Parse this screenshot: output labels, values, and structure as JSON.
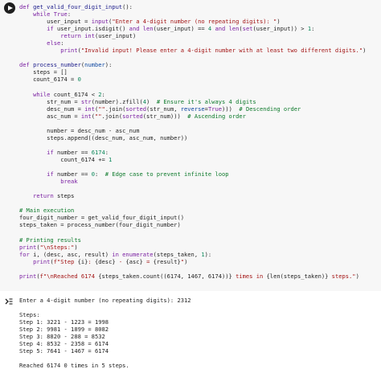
{
  "code_cell": {
    "lines": [
      [
        [
          "k",
          "def "
        ],
        [
          "d",
          "get_valid_four_digit_input"
        ],
        [
          "p",
          "():"
        ]
      ],
      [
        [
          "p",
          "    "
        ],
        [
          "k",
          "while "
        ],
        [
          "k",
          "True"
        ],
        [
          "p",
          ":"
        ]
      ],
      [
        [
          "p",
          "        user_input = "
        ],
        [
          "b",
          "input"
        ],
        [
          "p",
          "("
        ],
        [
          "s",
          "\"Enter a 4-digit number (no repeating digits): \""
        ],
        [
          "p",
          ")"
        ]
      ],
      [
        [
          "p",
          "        "
        ],
        [
          "k",
          "if "
        ],
        [
          "p",
          "user_input.isdigit() "
        ],
        [
          "k",
          "and "
        ],
        [
          "b",
          "len"
        ],
        [
          "p",
          "(user_input) == "
        ],
        [
          "n",
          "4"
        ],
        [
          "p",
          " "
        ],
        [
          "k",
          "and "
        ],
        [
          "b",
          "len"
        ],
        [
          "p",
          "("
        ],
        [
          "b",
          "set"
        ],
        [
          "p",
          "(user_input)) > "
        ],
        [
          "n",
          "1"
        ],
        [
          "p",
          ":"
        ]
      ],
      [
        [
          "p",
          "            "
        ],
        [
          "k",
          "return "
        ],
        [
          "b",
          "int"
        ],
        [
          "p",
          "(user_input)"
        ]
      ],
      [
        [
          "p",
          "        "
        ],
        [
          "k",
          "else"
        ],
        [
          "p",
          ":"
        ]
      ],
      [
        [
          "p",
          "            "
        ],
        [
          "b",
          "print"
        ],
        [
          "p",
          "("
        ],
        [
          "s",
          "\"Invalid input! Please enter a 4-digit number with at least two different digits.\""
        ],
        [
          "p",
          ")"
        ]
      ],
      [
        [
          "p",
          ""
        ]
      ],
      [
        [
          "k",
          "def "
        ],
        [
          "d",
          "process_number"
        ],
        [
          "p",
          "("
        ],
        [
          "v",
          "number"
        ],
        [
          "p",
          "):"
        ]
      ],
      [
        [
          "p",
          "    steps = []"
        ]
      ],
      [
        [
          "p",
          "    count_6174 = "
        ],
        [
          "n",
          "0"
        ]
      ],
      [
        [
          "p",
          ""
        ]
      ],
      [
        [
          "p",
          "    "
        ],
        [
          "k",
          "while "
        ],
        [
          "p",
          "count_6174 < "
        ],
        [
          "n",
          "2"
        ],
        [
          "p",
          ":"
        ]
      ],
      [
        [
          "p",
          "        str_num = "
        ],
        [
          "b",
          "str"
        ],
        [
          "p",
          "(number).zfill("
        ],
        [
          "n",
          "4"
        ],
        [
          "p",
          ")  "
        ],
        [
          "c",
          "# Ensure it's always 4 digits"
        ]
      ],
      [
        [
          "p",
          "        desc_num = "
        ],
        [
          "b",
          "int"
        ],
        [
          "p",
          "("
        ],
        [
          "s",
          "\"\""
        ],
        [
          "p",
          ".join("
        ],
        [
          "b",
          "sorted"
        ],
        [
          "p",
          "(str_num, "
        ],
        [
          "v",
          "reverse"
        ],
        [
          "p",
          "="
        ],
        [
          "k",
          "True"
        ],
        [
          "p",
          ")))  "
        ],
        [
          "c",
          "# Descending order"
        ]
      ],
      [
        [
          "p",
          "        asc_num = "
        ],
        [
          "b",
          "int"
        ],
        [
          "p",
          "("
        ],
        [
          "s",
          "\"\""
        ],
        [
          "p",
          ".join("
        ],
        [
          "b",
          "sorted"
        ],
        [
          "p",
          "(str_num)))  "
        ],
        [
          "c",
          "# Ascending order"
        ]
      ],
      [
        [
          "p",
          ""
        ]
      ],
      [
        [
          "p",
          "        number = desc_num - asc_num"
        ]
      ],
      [
        [
          "p",
          "        steps.append((desc_num, asc_num, number))"
        ]
      ],
      [
        [
          "p",
          ""
        ]
      ],
      [
        [
          "p",
          "        "
        ],
        [
          "k",
          "if "
        ],
        [
          "p",
          "number == "
        ],
        [
          "n",
          "6174"
        ],
        [
          "p",
          ":"
        ]
      ],
      [
        [
          "p",
          "            count_6174 += "
        ],
        [
          "n",
          "1"
        ]
      ],
      [
        [
          "p",
          ""
        ]
      ],
      [
        [
          "p",
          "        "
        ],
        [
          "k",
          "if "
        ],
        [
          "p",
          "number == "
        ],
        [
          "n",
          "0"
        ],
        [
          "p",
          ":  "
        ],
        [
          "c",
          "# Edge case to prevent infinite loop"
        ]
      ],
      [
        [
          "p",
          "            "
        ],
        [
          "k",
          "break"
        ]
      ],
      [
        [
          "p",
          ""
        ]
      ],
      [
        [
          "p",
          "    "
        ],
        [
          "k",
          "return "
        ],
        [
          "p",
          "steps"
        ]
      ],
      [
        [
          "p",
          ""
        ]
      ],
      [
        [
          "c",
          "# Main execution"
        ]
      ],
      [
        [
          "p",
          "four_digit_number = get_valid_four_digit_input()"
        ]
      ],
      [
        [
          "p",
          "steps_taken = process_number(four_digit_number)"
        ]
      ],
      [
        [
          "p",
          ""
        ]
      ],
      [
        [
          "c",
          "# Printing results"
        ]
      ],
      [
        [
          "b",
          "print"
        ],
        [
          "p",
          "("
        ],
        [
          "s",
          "\"\\nSteps:\""
        ],
        [
          "p",
          ")"
        ]
      ],
      [
        [
          "k",
          "for "
        ],
        [
          "p",
          "i, (desc, asc, result) "
        ],
        [
          "k",
          "in "
        ],
        [
          "b",
          "enumerate"
        ],
        [
          "p",
          "(steps_taken, "
        ],
        [
          "n",
          "1"
        ],
        [
          "p",
          "):"
        ]
      ],
      [
        [
          "p",
          "    "
        ],
        [
          "b",
          "print"
        ],
        [
          "p",
          "("
        ],
        [
          "s",
          "f\"Step "
        ],
        [
          "p",
          "{i}"
        ],
        [
          "s",
          ": "
        ],
        [
          "p",
          "{desc}"
        ],
        [
          "s",
          " - "
        ],
        [
          "p",
          "{asc}"
        ],
        [
          "s",
          " = "
        ],
        [
          "p",
          "{result}"
        ],
        [
          "s",
          "\""
        ],
        [
          "p",
          ")"
        ]
      ],
      [
        [
          "p",
          ""
        ]
      ],
      [
        [
          "b",
          "print"
        ],
        [
          "p",
          "("
        ],
        [
          "s",
          "f\"\\nReached 6174 "
        ],
        [
          "p",
          "{steps_taken.count((6174, 1467, 6174))}"
        ],
        [
          "s",
          " times in "
        ],
        [
          "p",
          "{len(steps_taken)}"
        ],
        [
          "s",
          " steps.\""
        ],
        [
          "p",
          ")"
        ]
      ]
    ]
  },
  "output": {
    "lines": [
      "Enter a 4-digit number (no repeating digits): 2312",
      "",
      "Steps:",
      "Step 1: 3221 - 1223 = 1998",
      "Step 2: 9981 - 1899 = 8082",
      "Step 3: 8820 - 288 = 8532",
      "Step 4: 8532 - 2358 = 6174",
      "Step 5: 7641 - 1467 = 6174",
      "",
      "Reached 6174 0 times in 5 steps."
    ]
  }
}
